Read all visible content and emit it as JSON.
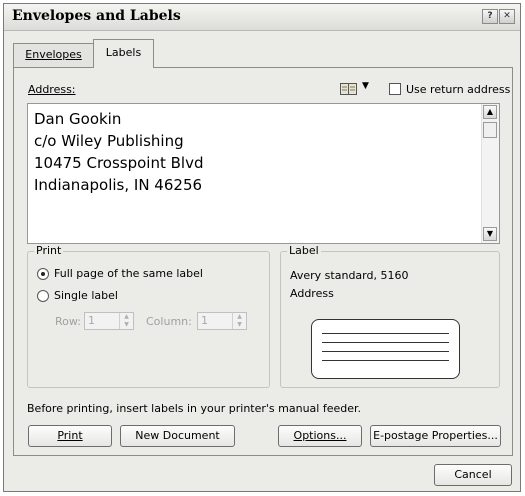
{
  "window": {
    "title": "Envelopes and Labels",
    "help_glyph": "?",
    "close_glyph": "✕"
  },
  "tabs": [
    {
      "label": "Envelopes",
      "active": false
    },
    {
      "label": "Labels",
      "active": true
    }
  ],
  "address": {
    "label": "Address:",
    "address_book_icon": "address-book-icon",
    "use_return_address_label": "Use return address",
    "use_return_address_checked": false,
    "lines": [
      "Dan Gookin",
      "c/o Wiley Publishing",
      "10475 Crosspoint Blvd",
      "Indianapolis, IN 46256"
    ]
  },
  "print_group": {
    "title": "Print",
    "options": [
      {
        "label": "Full page of the same label",
        "selected": true
      },
      {
        "label": "Single label",
        "selected": false
      }
    ],
    "row_label": "Row:",
    "row_value": "1",
    "column_label": "Column:",
    "column_value": "1"
  },
  "label_group": {
    "title": "Label",
    "line1": "Avery standard, 5160",
    "line2": "Address"
  },
  "hint": "Before printing, insert labels in your printer's manual feeder.",
  "buttons": {
    "print": "Print",
    "new_document": "New Document",
    "options": "Options...",
    "epostage": "E-postage Properties...",
    "cancel": "Cancel"
  },
  "colors": {
    "dialog_bg": "#ebebe7",
    "field_border": "#7f9db9"
  }
}
